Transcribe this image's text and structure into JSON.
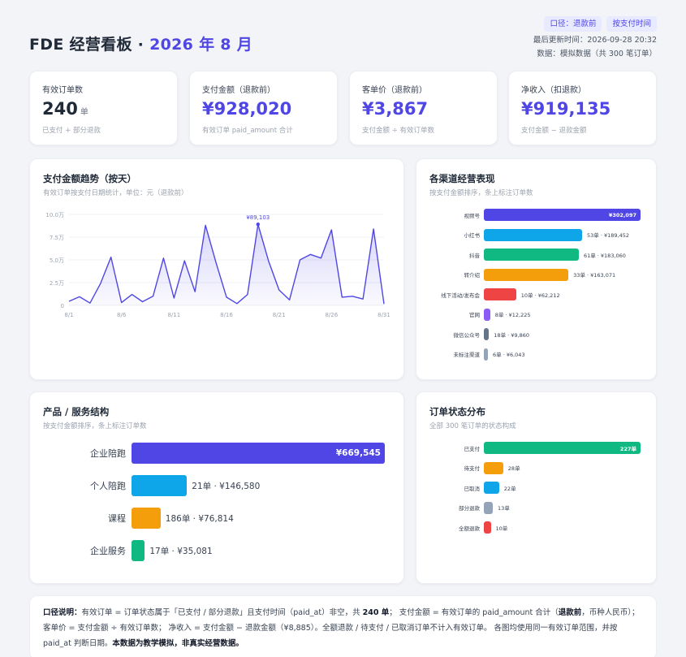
{
  "header": {
    "title_prefix": "FDE 经营看板 · ",
    "title_accent": "2026 年 8 月",
    "chip_refund": "口径：退款前",
    "chip_paytime": "按支付时间",
    "updated": "最后更新时间：2026-09-28 20:32",
    "source": "数据：模拟数据（共 300 笔订单）"
  },
  "kpis": [
    {
      "label": "有效订单数",
      "value": "240",
      "unit": "单",
      "sub": "已支付 + 部分退款"
    },
    {
      "label": "支付金额（退款前）",
      "value": "¥928,020",
      "sub": "有效订单 paid_amount 合计"
    },
    {
      "label": "客单价（退款前）",
      "value": "¥3,867",
      "sub": "支付金额 ÷ 有效订单数"
    },
    {
      "label": "净收入（扣退款）",
      "value": "¥919,135",
      "sub": "支付金额 − 退款金额"
    }
  ],
  "trend": {
    "title": "支付金额趋势（按天）",
    "subtitle": "有效订单按支付日期统计，单位：元（退款前）"
  },
  "channels": {
    "title": "各渠道经营表现",
    "subtitle": "按支付金额排序，条上标注订单数"
  },
  "products": {
    "title": "产品 / 服务结构",
    "subtitle": "按支付金额排序，条上标注订单数"
  },
  "status": {
    "title": "订单状态分布",
    "subtitle": "全部 300 笔订单的状态构成"
  },
  "note": {
    "lead": "口径说明：",
    "p1": "有效订单 = 订单状态属于「已支付 / 部分退款」且支付时间（paid_at）非空，共 ",
    "count": "240 单",
    "p2": "； 支付金额 = 有效订单的 paid_amount 合计（",
    "bold2": "退款前",
    "p3": "，币种人民币）；客单价 = 支付金额 ÷ 有效订单数； 净收入 = 支付金额 − 退款金额（¥8,885）。全额退款 / 待支付 / 已取消订单不计入有效订单。 各图均使用同一有效订单范围，并按 paid_at 判断日期。",
    "bold3": "本数据为教学模拟，非真实经营数据。"
  },
  "chart_data": [
    {
      "type": "area",
      "title": "支付金额趋势（按天）",
      "x": [
        "8/1",
        "8/2",
        "8/3",
        "8/4",
        "8/5",
        "8/6",
        "8/7",
        "8/8",
        "8/9",
        "8/10",
        "8/11",
        "8/12",
        "8/13",
        "8/14",
        "8/15",
        "8/16",
        "8/17",
        "8/18",
        "8/19",
        "8/20",
        "8/21",
        "8/22",
        "8/23",
        "8/24",
        "8/25",
        "8/26",
        "8/27",
        "8/28",
        "8/29",
        "8/30",
        "8/31"
      ],
      "y": [
        4500,
        9500,
        2500,
        24000,
        53000,
        3000,
        12000,
        4000,
        10000,
        52000,
        8000,
        49000,
        15000,
        88000,
        47000,
        9000,
        2000,
        12000,
        89103,
        49000,
        17000,
        6000,
        50000,
        56000,
        52000,
        83000,
        9000,
        10000,
        7000,
        84000,
        1500
      ],
      "x_ticks": [
        "8/1",
        "8/6",
        "8/11",
        "8/16",
        "8/21",
        "8/26",
        "8/31"
      ],
      "y_ticks": [
        "0",
        "2.5万",
        "5.0万",
        "7.5万",
        "10.0万"
      ],
      "ylim": [
        0,
        100000
      ],
      "max_label": "¥89,103",
      "grid": true,
      "color": "#4f46e5"
    },
    {
      "type": "bar",
      "orientation": "horizontal",
      "title": "各渠道经营表现",
      "categories": [
        "视频号",
        "小红书",
        "抖音",
        "转介绍",
        "线下活动/发布会",
        "官网",
        "微信公众号",
        "未标注渠道"
      ],
      "values": [
        302097,
        189452,
        183060,
        163071,
        62212,
        12225,
        9860,
        6043
      ],
      "labels": [
        "¥302,097",
        "53单 · ¥189,452",
        "61单 · ¥183,060",
        "33单 · ¥163,071",
        "10单 · ¥62,212",
        "8单 · ¥12,225",
        "18单 · ¥9,860",
        "6单 · ¥6,043"
      ],
      "colors": [
        "#4f46e5",
        "#0ea5e9",
        "#10b981",
        "#f59e0b",
        "#ef4444",
        "#8b5cf6",
        "#64748b",
        "#94a3b8"
      ]
    },
    {
      "type": "bar",
      "orientation": "horizontal",
      "title": "产品 / 服务结构",
      "categories": [
        "企业陪跑",
        "个人陪跑",
        "课程",
        "企业服务"
      ],
      "values": [
        669545,
        146580,
        76814,
        35081
      ],
      "labels": [
        "¥669,545",
        "21单 · ¥146,580",
        "186单 · ¥76,814",
        "17单 · ¥35,081"
      ],
      "colors": [
        "#4f46e5",
        "#0ea5e9",
        "#f59e0b",
        "#10b981"
      ]
    },
    {
      "type": "bar",
      "orientation": "horizontal",
      "title": "订单状态分布",
      "categories": [
        "已支付",
        "待支付",
        "已取消",
        "部分退款",
        "全额退款"
      ],
      "values": [
        227,
        28,
        22,
        13,
        10
      ],
      "labels": [
        "227单",
        "28单",
        "22单",
        "13单",
        "10单"
      ],
      "colors": [
        "#10b981",
        "#f59e0b",
        "#0ea5e9",
        "#94a3b8",
        "#ef4444"
      ]
    }
  ]
}
